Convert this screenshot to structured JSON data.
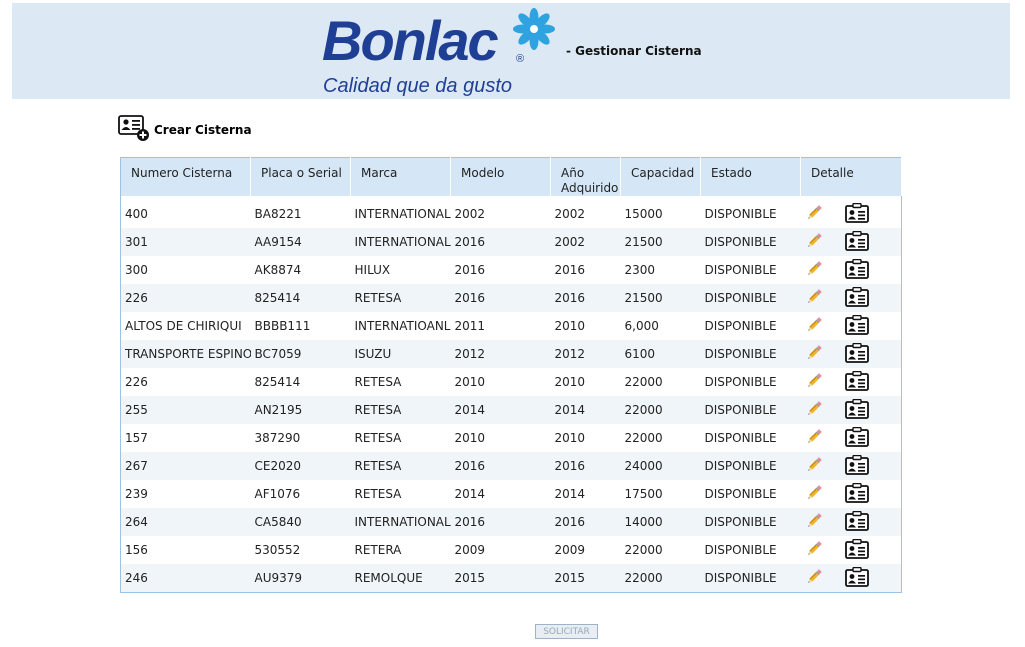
{
  "header": {
    "logo_text": "Bonlac",
    "logo_reg": "®",
    "logo_tagline": "Calidad que da gusto",
    "title": "- Gestionar Cisterna",
    "colors": {
      "header_bg": "#dce9f4",
      "brand": "#1f3f95",
      "flower": "#2fa3e0"
    }
  },
  "actions": {
    "create_label": "Crear Cisterna",
    "create_icon": "add-user-card-icon"
  },
  "table": {
    "columns": [
      "Numero Cisterna",
      "Placa o Serial",
      "Marca",
      "Modelo",
      "Año Adquirido",
      "Capacidad",
      "Estado",
      "Detalle"
    ],
    "rows": [
      [
        "400",
        "BA8221",
        "INTERNATIONAL",
        "2002",
        "2002",
        "15000",
        "DISPONIBLE"
      ],
      [
        "301",
        "AA9154",
        "INTERNATIONAL",
        "2016",
        "2002",
        "21500",
        "DISPONIBLE"
      ],
      [
        "300",
        "AK8874",
        "HILUX",
        "2016",
        "2016",
        "2300",
        "DISPONIBLE"
      ],
      [
        "226",
        "825414",
        "RETESA",
        "2016",
        "2016",
        "21500",
        "DISPONIBLE"
      ],
      [
        "ALTOS DE CHIRIQUI",
        "BBBB111",
        "INTERNATIOANL",
        "2011",
        "2010",
        "6,000",
        "DISPONIBLE"
      ],
      [
        "TRANSPORTE ESPINOZA",
        "BC7059",
        "ISUZU",
        "2012",
        "2012",
        "6100",
        "DISPONIBLE"
      ],
      [
        "226",
        "825414",
        "RETESA",
        "2010",
        "2010",
        "22000",
        "DISPONIBLE"
      ],
      [
        "255",
        "AN2195",
        "RETESA",
        "2014",
        "2014",
        "22000",
        "DISPONIBLE"
      ],
      [
        "157",
        "387290",
        "RETESA",
        "2010",
        "2010",
        "22000",
        "DISPONIBLE"
      ],
      [
        "267",
        "CE2020",
        "RETESA",
        "2016",
        "2016",
        "24000",
        "DISPONIBLE"
      ],
      [
        "239",
        "AF1076",
        "RETESA",
        "2014",
        "2014",
        "17500",
        "DISPONIBLE"
      ],
      [
        "264",
        "CA5840",
        "INTERNATIONAL",
        "2016",
        "2016",
        "14000",
        "DISPONIBLE"
      ],
      [
        "156",
        "530552",
        "RETERA",
        "2009",
        "2009",
        "22000",
        "DISPONIBLE"
      ],
      [
        "246",
        "AU9379",
        "REMOLQUE",
        "2015",
        "2015",
        "22000",
        "DISPONIBLE"
      ]
    ],
    "row_icons": [
      "pencil-icon",
      "id-card-icon"
    ]
  },
  "submit": {
    "label": "SOLICITAR"
  }
}
